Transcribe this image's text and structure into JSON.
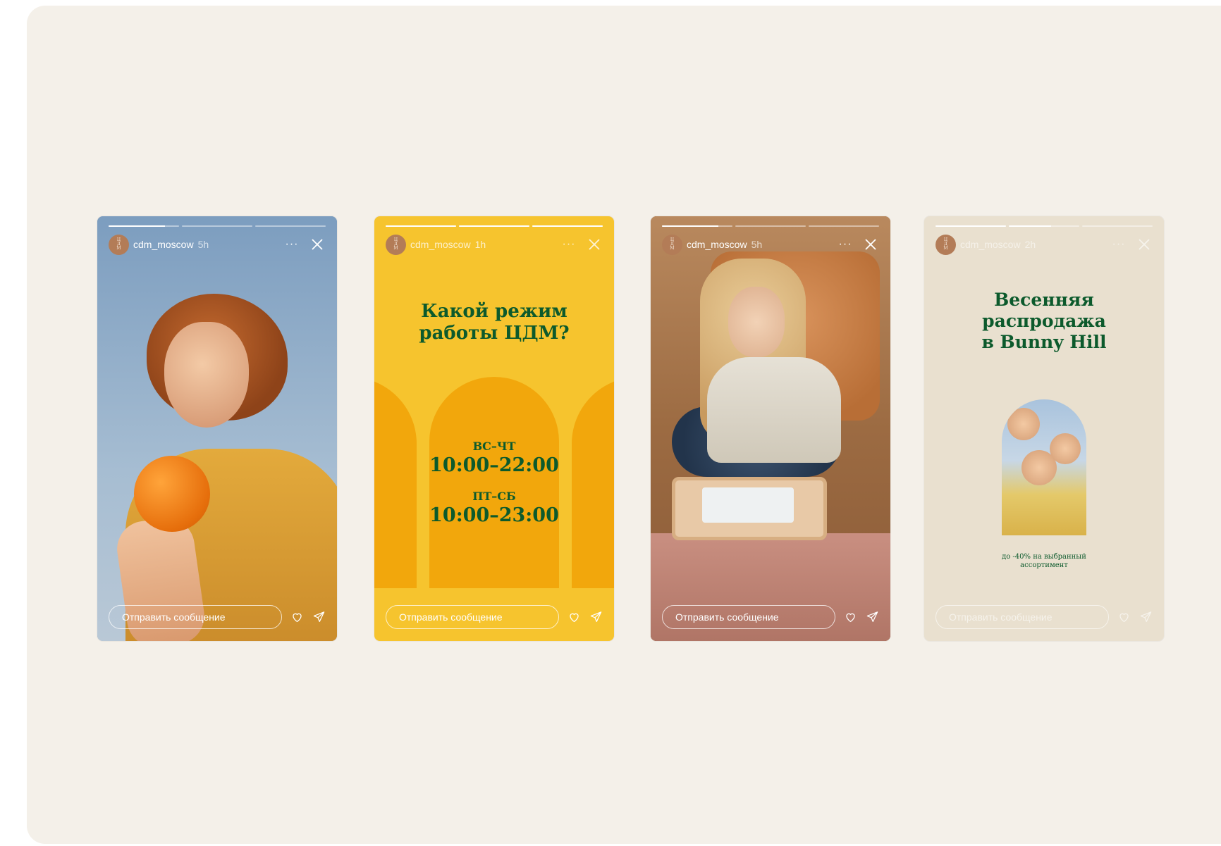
{
  "stories": [
    {
      "username": "cdm_moscow",
      "time": "5h",
      "avatar_text": "Ц\nД\nМ",
      "more_label": "···",
      "message_placeholder": "Отправить сообщение",
      "progress": [
        0.8,
        0.0,
        0.0
      ]
    },
    {
      "username": "cdm_moscow",
      "time": "1h",
      "avatar_text": "Ц\nД\nМ",
      "more_label": "···",
      "message_placeholder": "Отправить сообщение",
      "title_line1": "Какой режим",
      "title_line2": "работы ЦДМ?",
      "hours": [
        {
          "days": "ВС–ЧТ",
          "time": "10:00–22:00"
        },
        {
          "days": "ПТ–СБ",
          "time": "10:00–23:00"
        }
      ],
      "progress": [
        1.0,
        1.0,
        1.0
      ]
    },
    {
      "username": "cdm_moscow",
      "time": "5h",
      "avatar_text": "Ц\nД\nМ",
      "more_label": "···",
      "message_placeholder": "Отправить сообщение",
      "progress": [
        0.8,
        0.0,
        0.0
      ]
    },
    {
      "username": "cdm_moscow",
      "time": "2h",
      "avatar_text": "Ц\nД\nМ",
      "more_label": "···",
      "message_placeholder": "Отправить сообщение",
      "title_line1": "Весенняя",
      "title_line2": "распродажа",
      "title_line3": "в Bunny Hill",
      "note_line1": "до -40% на выбранный",
      "note_line2": "ассортимент",
      "progress": [
        1.0,
        0.6,
        0.0
      ]
    }
  ],
  "colors": {
    "board": "#f4f0e9",
    "brand_green": "#0c5a2c",
    "story_yellow": "#f6c42e",
    "arch_orange": "#f2a70c",
    "story_beige": "#e9e0cf"
  }
}
